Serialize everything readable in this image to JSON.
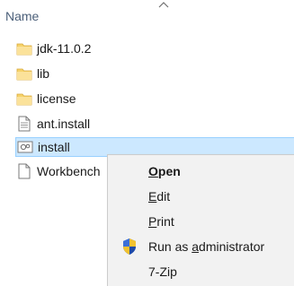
{
  "header": {
    "name_label": "Name"
  },
  "files": [
    {
      "name": "jdk-11.0.2",
      "icon": "folder-icon"
    },
    {
      "name": "lib",
      "icon": "folder-icon"
    },
    {
      "name": "license",
      "icon": "folder-icon"
    },
    {
      "name": "ant.install",
      "icon": "text-file-icon"
    },
    {
      "name": "install",
      "icon": "settings-file-icon",
      "selected": true
    },
    {
      "name": "Workbench",
      "icon": "blank-file-icon"
    }
  ],
  "context_menu": {
    "items": [
      {
        "label": "Open",
        "accesskey": "O",
        "rest": "pen",
        "default": true
      },
      {
        "label": "Edit",
        "accesskey": "E",
        "rest": "dit"
      },
      {
        "label": "Print",
        "accesskey": "P",
        "rest": "rint"
      },
      {
        "label": "Run as administrator",
        "pre": "Run as ",
        "accesskey": "a",
        "rest": "dministrator",
        "icon": "uac-shield-icon"
      },
      {
        "label": "7-Zip",
        "icon": ""
      }
    ]
  },
  "colors": {
    "selection_bg": "#cce8ff",
    "selection_border": "#99d1ff",
    "folder": "#f6d36b",
    "menu_bg": "#f2f2f2",
    "header_text": "#4c607a"
  }
}
